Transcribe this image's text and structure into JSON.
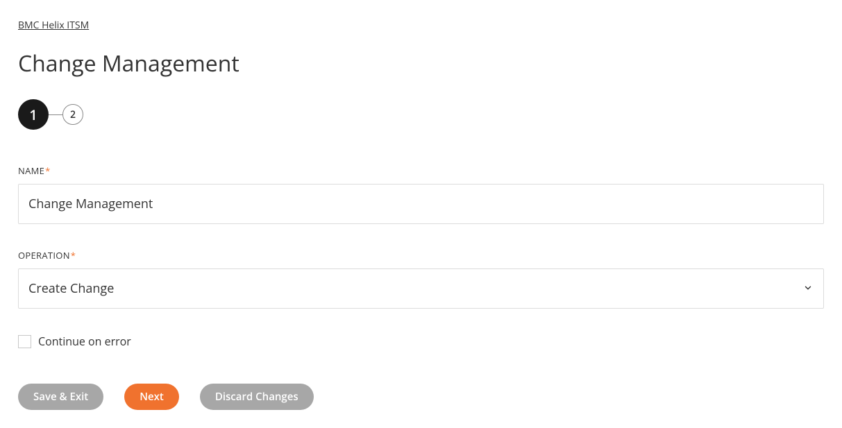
{
  "breadcrumb": "BMC Helix ITSM",
  "page_title": "Change Management",
  "stepper": {
    "steps": [
      "1",
      "2"
    ],
    "active_index": 0
  },
  "form": {
    "name": {
      "label": "NAME",
      "required": true,
      "value": "Change Management"
    },
    "operation": {
      "label": "OPERATION",
      "required": true,
      "selected": "Create Change"
    },
    "continue_on_error": {
      "label": "Continue on error",
      "checked": false
    }
  },
  "buttons": {
    "save_exit": "Save & Exit",
    "next": "Next",
    "discard": "Discard Changes"
  }
}
